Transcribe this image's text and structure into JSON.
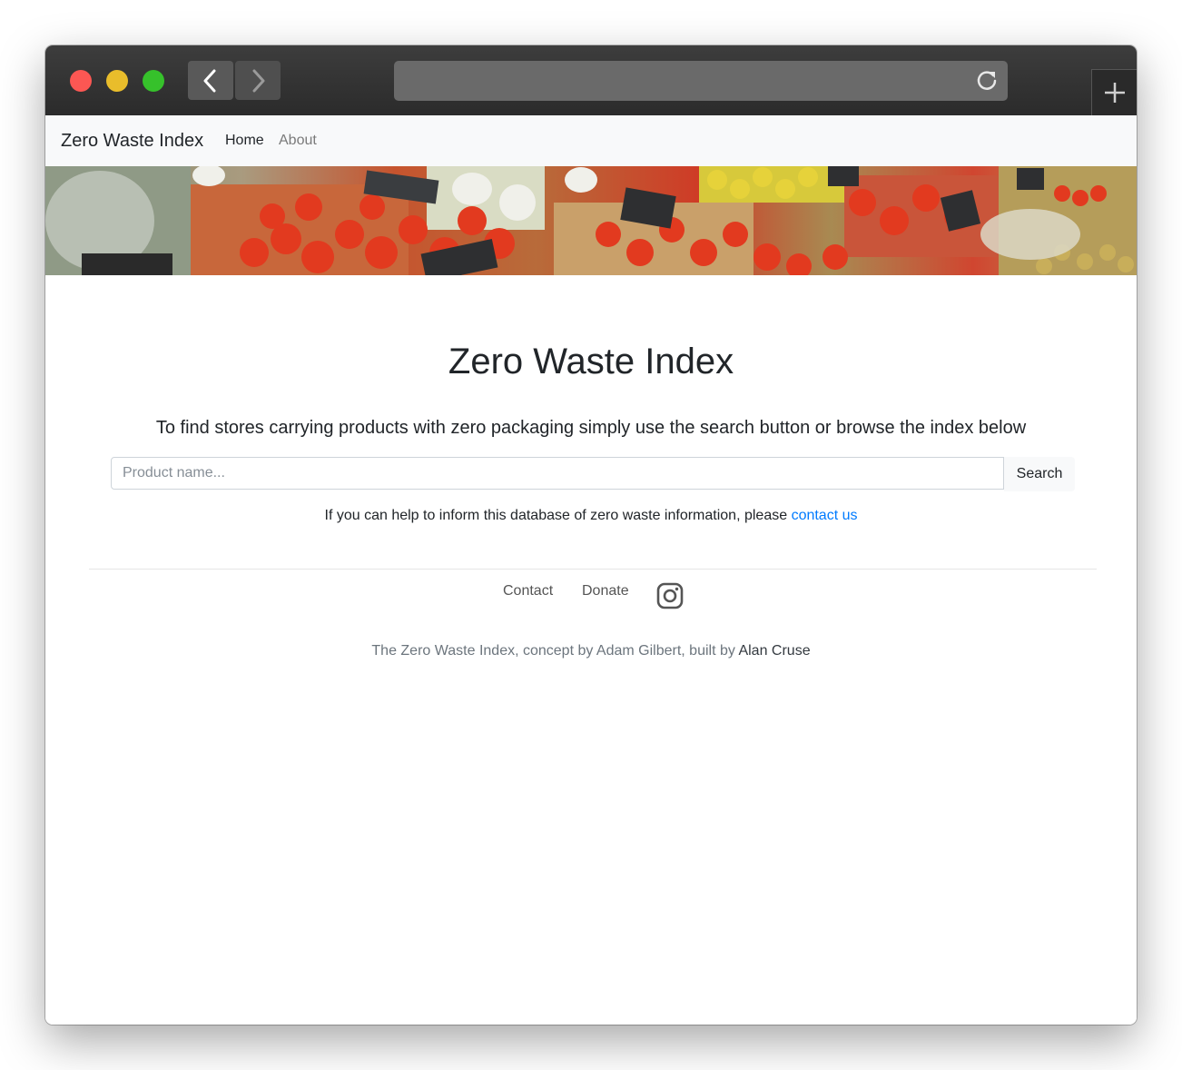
{
  "browser": {
    "url": "",
    "icons": {
      "back": "chevron-left-icon",
      "forward": "chevron-right-icon",
      "reload": "reload-icon",
      "new_tab": "plus-icon"
    }
  },
  "navbar": {
    "brand": "Zero Waste Index",
    "links": [
      "Home",
      "About"
    ]
  },
  "hero": {
    "title": "Zero Waste Index",
    "subtitle": "To find stores carrying products with zero packaging simply use the search button or browse the index below"
  },
  "search": {
    "placeholder": "Product name...",
    "value": "",
    "button_label": "Search"
  },
  "help": {
    "text": "If you can help to inform this database of zero waste information, please ",
    "link": "contact us"
  },
  "footer": {
    "links": [
      "Contact",
      "Donate"
    ],
    "social_icon": "instagram-icon",
    "credits_prefix": "The Zero Waste Index, concept by Adam Gilbert, built by ",
    "credits_author": "Alan Cruse"
  },
  "colors": {
    "link": "#007bff",
    "navbar_bg": "#f8f9fa",
    "chrome_bg": "#2b2b2b"
  }
}
